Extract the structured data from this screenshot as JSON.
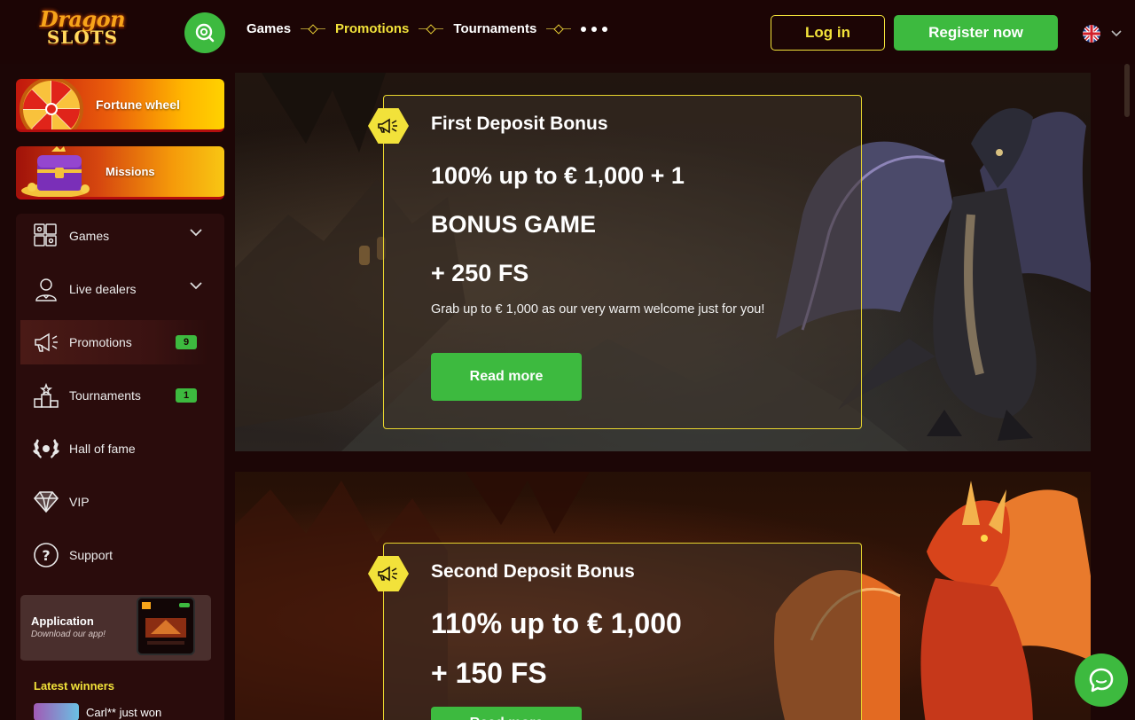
{
  "header": {
    "logo_line1": "Dragon",
    "logo_line2": "SLOTS",
    "nav": [
      {
        "label": "Games"
      },
      {
        "label": "Promotions"
      },
      {
        "label": "Tournaments"
      }
    ],
    "login_label": "Log in",
    "register_label": "Register now",
    "language": "en"
  },
  "sidebar": {
    "banners": [
      {
        "label": "Fortune wheel"
      },
      {
        "label": "Missions"
      }
    ],
    "menu": [
      {
        "label": "Games",
        "expandable": true
      },
      {
        "label": "Live dealers",
        "expandable": true
      },
      {
        "label": "Promotions",
        "badge": "9",
        "active": true
      },
      {
        "label": "Tournaments",
        "badge": "1"
      },
      {
        "label": "Hall of fame"
      },
      {
        "label": "VIP"
      },
      {
        "label": "Support"
      }
    ],
    "app": {
      "title": "Application",
      "subtitle": "Download our app!"
    },
    "latest_winners_label": "Latest winners",
    "winner_text": "Carl** just won"
  },
  "promotions": [
    {
      "title": "First Deposit Bonus",
      "lines": [
        "100% up to € 1,000 + 1",
        "BONUS GAME",
        "+ 250 FS"
      ],
      "description": "Grab up to € 1,000 as our very warm welcome just for you!",
      "button": "Read more"
    },
    {
      "title": "Second Deposit Bonus",
      "lines": [
        "110% up to € 1,000",
        "+ 150 FS"
      ],
      "button": "Read more"
    }
  ],
  "colors": {
    "accent_green": "#3dba3f",
    "accent_yellow": "#f2e23a",
    "background": "#1c0606"
  }
}
